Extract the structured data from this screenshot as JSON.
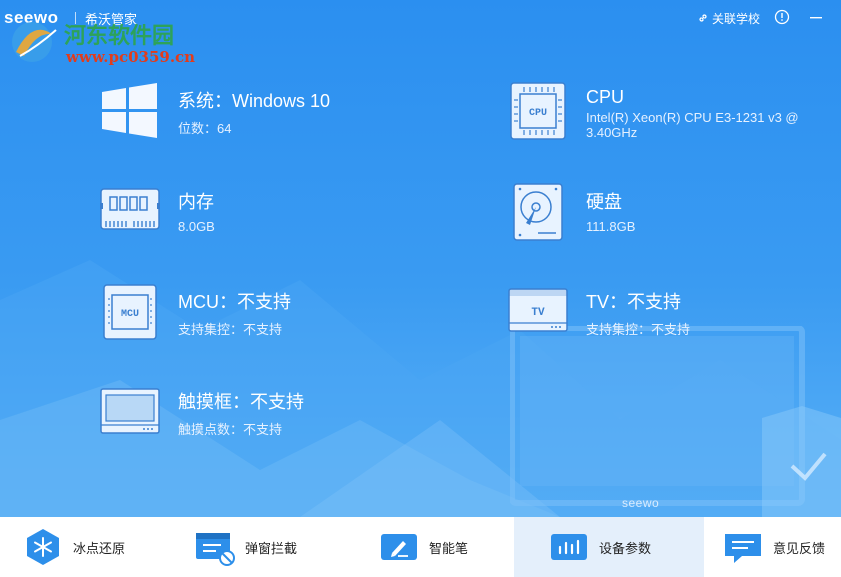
{
  "app": {
    "brand": "seewo",
    "title": "希沃管家",
    "associate_school": "关联学校"
  },
  "watermark": {
    "site_name": "河东软件园",
    "url": "www.pc0359.cn"
  },
  "items": [
    {
      "id": "system",
      "title": "系统：Windows 10",
      "subtitle": "位数：64",
      "icon": "windows-icon"
    },
    {
      "id": "cpu",
      "title": "CPU",
      "subtitle": "Intel(R) Xeon(R) CPU E3-1231 v3 @ 3.40GHz",
      "icon": "cpu-icon",
      "icon_text": "CPU"
    },
    {
      "id": "memory",
      "title": "内存",
      "subtitle": "8.0GB",
      "icon": "memory-icon"
    },
    {
      "id": "disk",
      "title": "硬盘",
      "subtitle": "111.8GB",
      "icon": "hard-disk-icon"
    },
    {
      "id": "mcu",
      "title": "MCU：不支持",
      "subtitle": "支持集控：不支持",
      "icon": "mcu-icon",
      "icon_text": "MCU"
    },
    {
      "id": "tv",
      "title": "TV：不支持",
      "subtitle": "支持集控：不支持",
      "icon": "tv-icon",
      "icon_text": "TV"
    },
    {
      "id": "touch",
      "title": "触摸框：不支持",
      "subtitle": "触摸点数：不支持",
      "icon": "touch-frame-icon"
    }
  ],
  "background_device_label": "seewo",
  "tabs": [
    {
      "label": "冰点还原",
      "icon": "snowflake-icon",
      "active": false
    },
    {
      "label": "弹窗拦截",
      "icon": "popup-block-icon",
      "active": false
    },
    {
      "label": "智能笔",
      "icon": "smart-pen-icon",
      "active": false
    },
    {
      "label": "设备参数",
      "icon": "device-params-icon",
      "active": true
    },
    {
      "label": "意见反馈",
      "icon": "feedback-icon",
      "active": false
    }
  ],
  "colors": {
    "background": "#2f8fea",
    "icon_fill": "#e8f3ff",
    "icon_stroke": "#3a7fd0",
    "active_tab": "#e4effb",
    "tab_icon": "#2d8fea"
  }
}
